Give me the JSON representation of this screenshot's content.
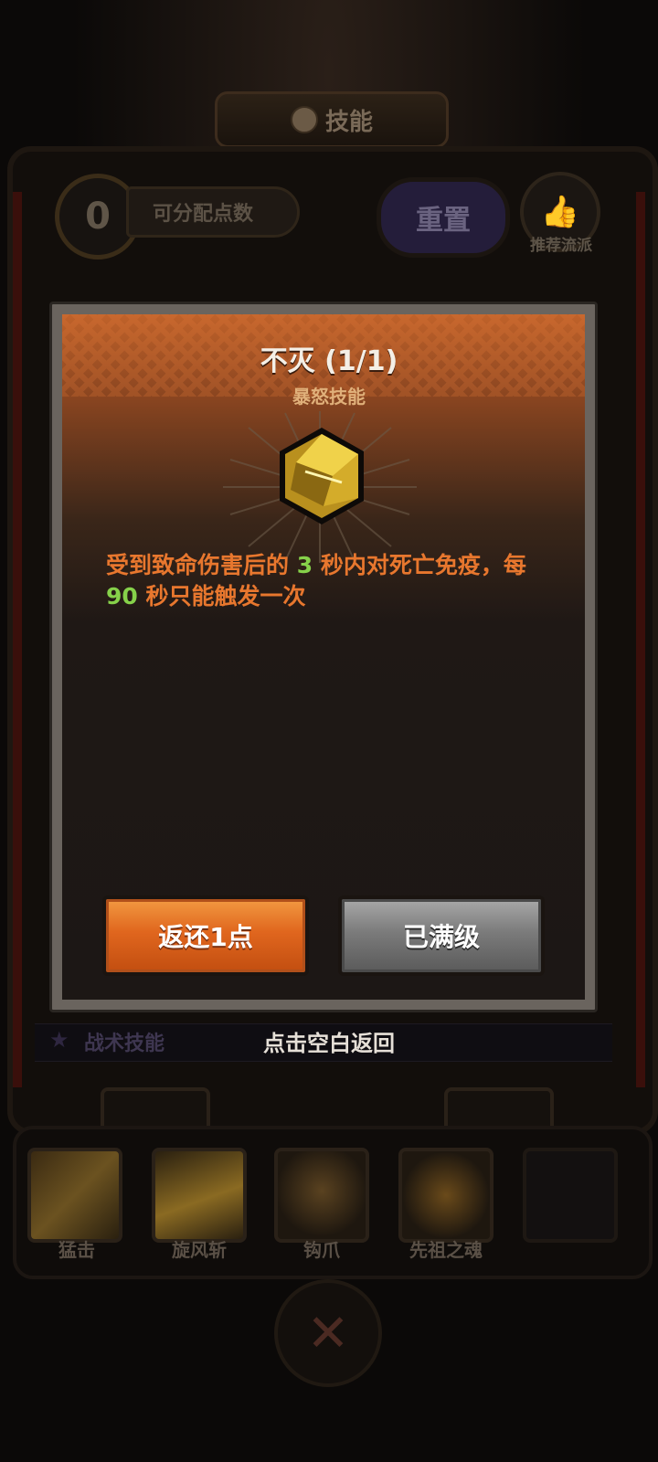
{
  "header": {
    "title": "技能"
  },
  "points": {
    "value": "0",
    "label": "可分配点数"
  },
  "reset_label": "重置",
  "recommend_label": "推荐流派",
  "modal": {
    "title": "不灭 (1/1)",
    "subtitle": "暴怒技能",
    "desc_part1": "受到致命伤害后的 ",
    "desc_num1": "3",
    "desc_part2": " 秒内对死亡免疫，每",
    "desc_num2": "90",
    "desc_part3": " 秒只能触发一次",
    "refund_label": "返还1点",
    "max_label": "已满级"
  },
  "tactics_label": "战术技能",
  "tap_blank_label": "点击空白返回",
  "skills": [
    {
      "name": "猛击"
    },
    {
      "name": "旋风斩"
    },
    {
      "name": "钩爪"
    },
    {
      "name": "先祖之魂"
    }
  ],
  "colors": {
    "accent_orange": "#e8772e",
    "number_green": "#86d14a",
    "refund_button": "#e0661e",
    "max_button": "#7b7b7b"
  }
}
